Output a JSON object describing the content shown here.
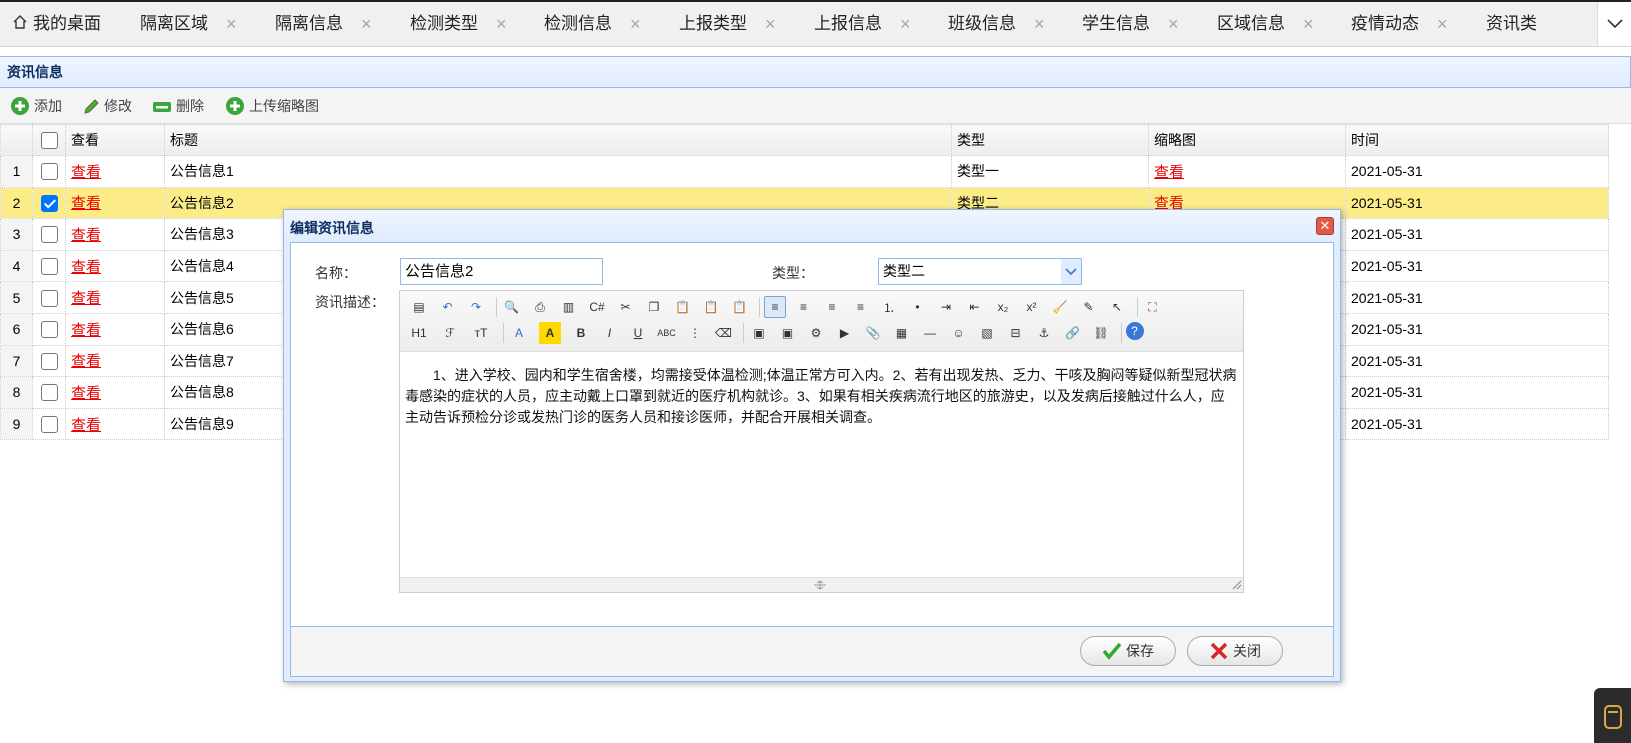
{
  "tabs": {
    "home": "我的桌面",
    "items": [
      {
        "label": "隔离区域"
      },
      {
        "label": "隔离信息"
      },
      {
        "label": "检测类型"
      },
      {
        "label": "检测信息"
      },
      {
        "label": "上报类型"
      },
      {
        "label": "上报信息"
      },
      {
        "label": "班级信息"
      },
      {
        "label": "学生信息"
      },
      {
        "label": "区域信息"
      },
      {
        "label": "疫情动态"
      },
      {
        "label": "资讯类"
      }
    ],
    "close_glyph": "×"
  },
  "panel": {
    "title": "资讯信息",
    "toolbar": {
      "add": "添加",
      "edit": "修改",
      "delete": "删除",
      "upload_thumb": "上传缩略图"
    }
  },
  "grid": {
    "columns": {
      "view": "查看",
      "title": "标题",
      "type": "类型",
      "thumb": "缩略图",
      "time": "时间"
    },
    "rows": [
      {
        "num": "1",
        "checked": false,
        "view": "查看",
        "title": "公告信息1",
        "type": "类型一",
        "thumb": "查看",
        "time": "2021-05-31"
      },
      {
        "num": "2",
        "checked": true,
        "view": "查看",
        "title": "公告信息2",
        "type": "类型二",
        "thumb": "查看",
        "time": "2021-05-31"
      },
      {
        "num": "3",
        "checked": false,
        "view": "查看",
        "title": "公告信息3",
        "type": "",
        "thumb": "",
        "time": "2021-05-31"
      },
      {
        "num": "4",
        "checked": false,
        "view": "查看",
        "title": "公告信息4",
        "type": "",
        "thumb": "",
        "time": "2021-05-31"
      },
      {
        "num": "5",
        "checked": false,
        "view": "查看",
        "title": "公告信息5",
        "type": "",
        "thumb": "",
        "time": "2021-05-31"
      },
      {
        "num": "6",
        "checked": false,
        "view": "查看",
        "title": "公告信息6",
        "type": "",
        "thumb": "",
        "time": "2021-05-31"
      },
      {
        "num": "7",
        "checked": false,
        "view": "查看",
        "title": "公告信息7",
        "type": "",
        "thumb": "",
        "time": "2021-05-31"
      },
      {
        "num": "8",
        "checked": false,
        "view": "查看",
        "title": "公告信息8",
        "type": "",
        "thumb": "",
        "time": "2021-05-31"
      },
      {
        "num": "9",
        "checked": false,
        "view": "查看",
        "title": "公告信息9",
        "type": "",
        "thumb": "",
        "time": "2021-05-31"
      }
    ]
  },
  "dialog": {
    "title": "编辑资讯信息",
    "close_glyph": "✕",
    "name_label": "名称：",
    "name_value": "公告信息2",
    "type_label": "类型：",
    "type_value": "类型二",
    "desc_label": "资讯描述：",
    "editor_toolbar": {
      "heading": "H1",
      "font_family": "ℱ",
      "font_size": "тT",
      "font_color": "A",
      "bg_color": "A",
      "bold": "B",
      "italic": "I",
      "underline": "U",
      "strike": "ABC"
    },
    "content": "1、进入学校、园内和学生宿舍楼，均需接受体温检测;体温正常方可入内。2、若有出现发热、乏力、干咳及胸闷等疑似新型冠状病毒感染的症状的人员，应主动戴上口罩到就近的医疗机构就诊。3、如果有相关疾病流行地区的旅游史，以及发病后接触过什么人，应主动告诉预检分诊或发热门诊的医务人员和接诊医师，并配合开展相关调查。",
    "save_label": "保存",
    "close_label": "关闭"
  },
  "colors": {
    "accent_border": "#95b8e7",
    "selected_row": "#fbec88",
    "link_red": "#e00000",
    "save_check": "#2fa82f",
    "close_x": "#d8262a"
  }
}
